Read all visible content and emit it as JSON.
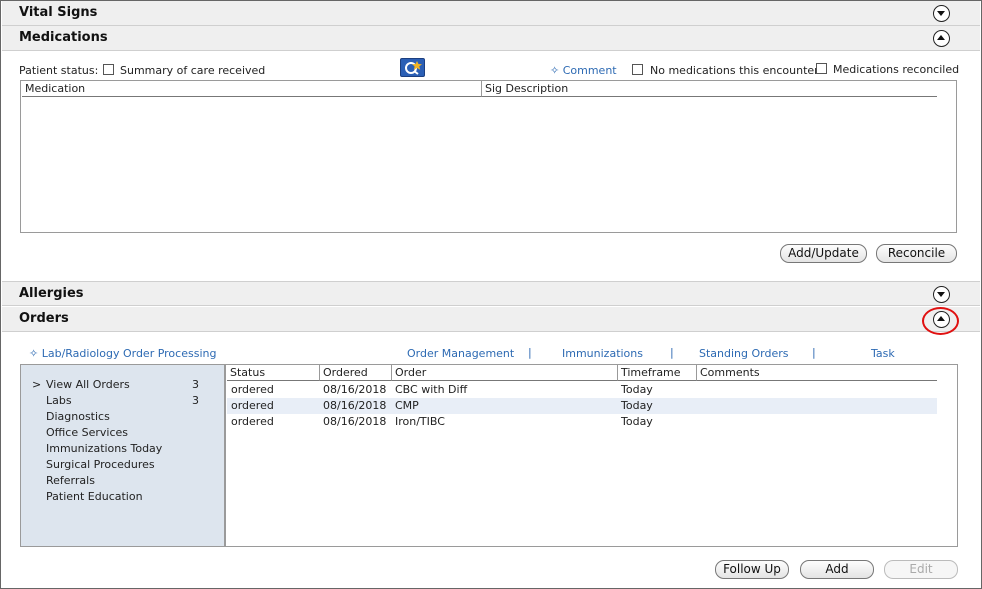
{
  "sections": {
    "vital_signs": "Vital Signs",
    "medications": "Medications",
    "allergies": "Allergies",
    "orders": "Orders"
  },
  "medications": {
    "patient_status_label": "Patient status:",
    "summary_checkbox_label": "Summary of care received",
    "comment_link": "✧ Comment",
    "no_meds_label": "No medications this encounter",
    "meds_reconciled_label": "Medications reconciled",
    "columns": [
      "Medication",
      "Sig Description"
    ],
    "add_update_button": "Add/Update",
    "reconcile_button": "Reconcile"
  },
  "orders": {
    "lab_radiology_link": "✧ Lab/Radiology Order Processing",
    "nav_links": [
      "Order Management",
      "Immunizations",
      "Standing Orders",
      "Task"
    ],
    "separator": "|",
    "categories": [
      {
        "label": "View All Orders",
        "count": "3",
        "selected": true
      },
      {
        "label": "Labs",
        "count": "3"
      },
      {
        "label": "Diagnostics",
        "count": ""
      },
      {
        "label": "Office Services",
        "count": ""
      },
      {
        "label": "Immunizations Today",
        "count": ""
      },
      {
        "label": "Surgical Procedures",
        "count": ""
      },
      {
        "label": "Referrals",
        "count": ""
      },
      {
        "label": "Patient Education",
        "count": ""
      }
    ],
    "selected_marker": ">",
    "columns": [
      "Status",
      "Ordered",
      "Order",
      "Timeframe",
      "Comments"
    ],
    "rows": [
      {
        "status": "ordered",
        "ordered": "08/16/2018",
        "order": "CBC with Diff",
        "timeframe": "Today",
        "comments": ""
      },
      {
        "status": "ordered",
        "ordered": "08/16/2018",
        "order": "CMP",
        "timeframe": "Today",
        "comments": ""
      },
      {
        "status": "ordered",
        "ordered": "08/16/2018",
        "order": "Iron/TIBC",
        "timeframe": "Today",
        "comments": ""
      }
    ],
    "follow_up_button": "Follow Up",
    "add_button": "Add",
    "edit_button": "Edit"
  },
  "icons": {
    "expand": "chevron-down-icon",
    "collapse": "chevron-up-icon",
    "reconcile_app": "medication-reconcile-icon"
  },
  "colors": {
    "link": "#2d6ab3",
    "highlight_ring": "#e01010",
    "alt_row": "#e8eef7",
    "left_panel": "#dde5ee"
  }
}
